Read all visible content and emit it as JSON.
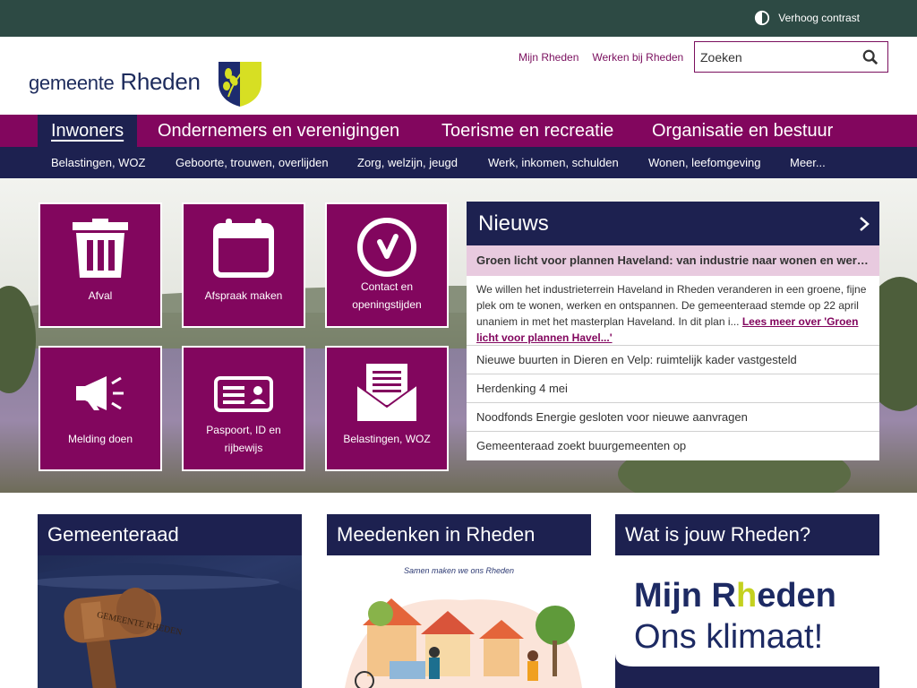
{
  "topbar": {
    "contrast_label": "Verhoog contrast"
  },
  "header": {
    "logo_prefix": "gemeente",
    "logo_name": "Rheden",
    "links": [
      "Mijn Rheden",
      "Werken bij Rheden"
    ],
    "search": {
      "placeholder": "Zoeken",
      "value": ""
    }
  },
  "mainnav": {
    "tabs": [
      {
        "label": "Inwoners"
      },
      {
        "label": "Ondernemers en verenigingen"
      },
      {
        "label": "Toerisme en recreatie"
      },
      {
        "label": "Organisatie en bestuur"
      }
    ],
    "active": "Inwoners"
  },
  "subnav": {
    "items": [
      "Belastingen, WOZ",
      "Geboorte, trouwen, overlijden",
      "Zorg, welzijn, jeugd",
      "Werk, inkomen, schulden",
      "Wonen, leefomgeving",
      "Meer..."
    ]
  },
  "tiles": [
    {
      "label": "Afval",
      "icon": "trash-bin-icon"
    },
    {
      "label": "Afspraak maken",
      "icon": "calendar-icon"
    },
    {
      "label": "Contact en openingstijden",
      "icon": "clock-icon"
    },
    {
      "label": "Melding doen",
      "icon": "megaphone-icon"
    },
    {
      "label": "Paspoort, ID en rijbewijs",
      "icon": "id-card-icon"
    },
    {
      "label": "Belastingen, WOZ",
      "icon": "envelope-letter-icon"
    }
  ],
  "news": {
    "title": "Nieuws",
    "featured_title": "Groen licht voor plannen Haveland: van industrie naar wonen en werken",
    "featured_summary": "We willen het industrieterrein Haveland in Rheden veranderen in een groene, fijne plek om te wonen, werken en ontspannen. De gemeenteraad stemde op 22 april unaniem in met het masterplan Haveland. In dit plan i... ",
    "read_more": "Lees meer over 'Groen licht voor plannen Havel...'",
    "items": [
      "Nieuwe buurten in Dieren en Velp: ruimtelijk kader vastgesteld",
      "Herdenking 4 mei",
      "Noodfonds Energie gesloten voor nieuwe aanvragen",
      "Gemeenteraad zoekt buurgemeenten op"
    ]
  },
  "cards": [
    {
      "title": "Gemeenteraad",
      "image_text": "GEMEENTE RHEDEN"
    },
    {
      "title": "Meedenken in Rheden",
      "image_caption": "Samen maken we ons Rheden"
    },
    {
      "title": "Wat is jouw Rheden?",
      "brand_line1_a": "Mijn R",
      "brand_line1_h": "h",
      "brand_line1_b": "eden",
      "brand_line2": "Ons klimaat!"
    }
  ],
  "colors": {
    "brand_purple": "#82065e",
    "brand_navy": "#1d2150",
    "topbar_green": "#2d4a44",
    "accent_lime": "#c4d11f"
  }
}
